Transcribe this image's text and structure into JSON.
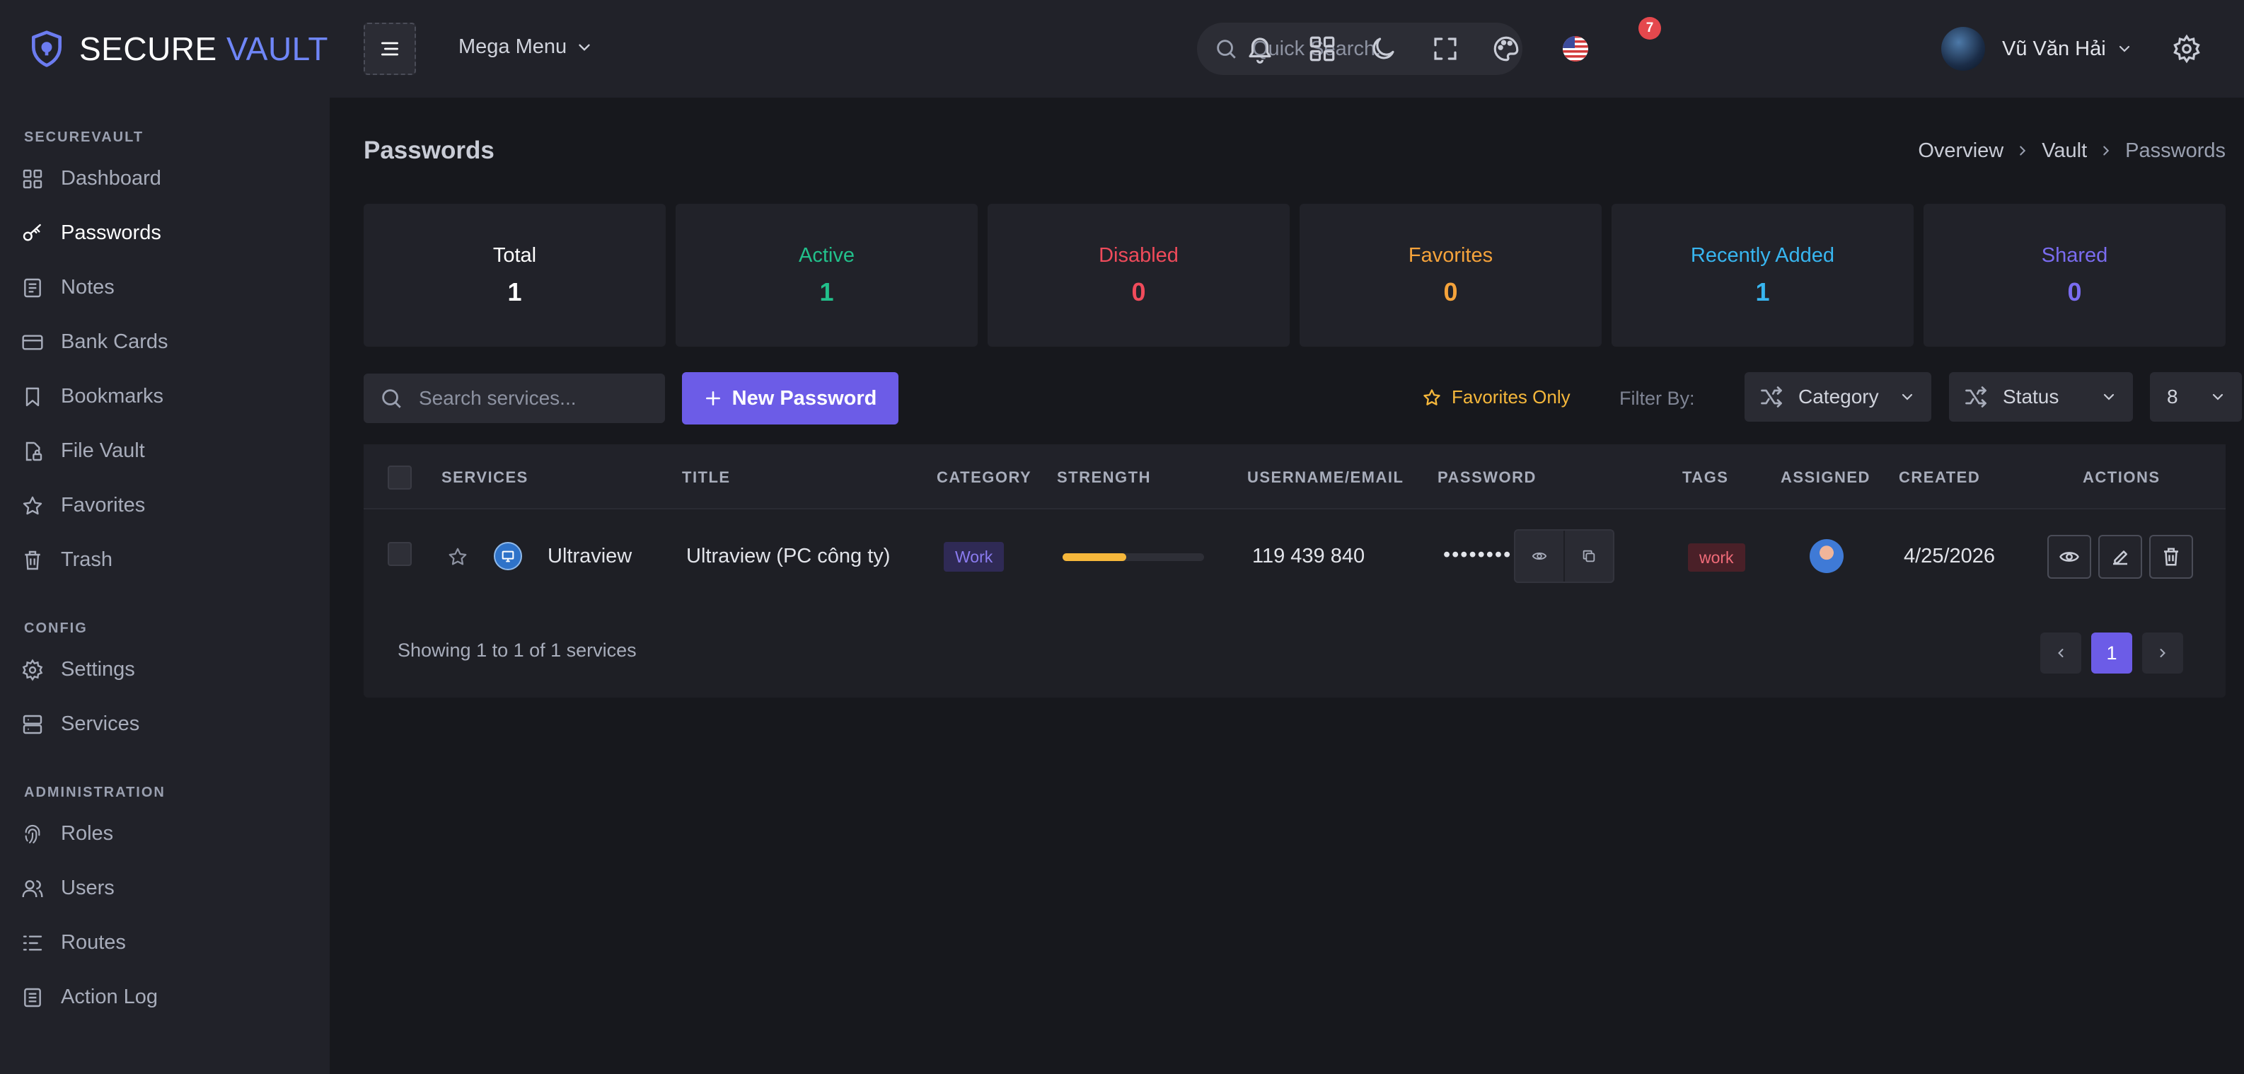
{
  "brand": {
    "name_main": "SECURE",
    "name_accent": "VAULT",
    "accent_color": "#6f86f7"
  },
  "sidebar": {
    "sections": [
      {
        "title": "SECUREVAULT",
        "items": [
          {
            "label": "Dashboard",
            "icon": "dashboard-icon"
          },
          {
            "label": "Passwords",
            "icon": "key-icon",
            "active": true
          },
          {
            "label": "Notes",
            "icon": "notes-icon"
          },
          {
            "label": "Bank Cards",
            "icon": "credit-card-icon"
          },
          {
            "label": "Bookmarks",
            "icon": "bookmark-icon"
          },
          {
            "label": "File Vault",
            "icon": "file-lock-icon"
          },
          {
            "label": "Favorites",
            "icon": "star-icon"
          },
          {
            "label": "Trash",
            "icon": "trash-icon"
          }
        ]
      },
      {
        "title": "CONFIG",
        "items": [
          {
            "label": "Settings",
            "icon": "gear-icon"
          },
          {
            "label": "Services",
            "icon": "server-icon"
          }
        ]
      },
      {
        "title": "ADMINISTRATION",
        "items": [
          {
            "label": "Roles",
            "icon": "fingerprint-icon"
          },
          {
            "label": "Users",
            "icon": "users-icon"
          },
          {
            "label": "Routes",
            "icon": "routes-icon"
          },
          {
            "label": "Action Log",
            "icon": "log-icon"
          }
        ]
      }
    ]
  },
  "topbar": {
    "mega_menu": "Mega Menu",
    "search_placeholder": "Quick Search...",
    "notification_count": "7",
    "user_name": "Vũ Văn Hải"
  },
  "page": {
    "title": "Passwords",
    "breadcrumb": [
      "Overview",
      "Vault",
      "Passwords"
    ]
  },
  "stats": [
    {
      "label": "Total",
      "value": "1",
      "color": "#ffffff"
    },
    {
      "label": "Active",
      "value": "1",
      "color": "#22c08b"
    },
    {
      "label": "Disabled",
      "value": "0",
      "color": "#f04b5b"
    },
    {
      "label": "Favorites",
      "value": "0",
      "color": "#f5a33b"
    },
    {
      "label": "Recently Added",
      "value": "1",
      "color": "#38b6f0"
    },
    {
      "label": "Shared",
      "value": "0",
      "color": "#7a6cf0"
    }
  ],
  "toolbar": {
    "search_placeholder": "Search services...",
    "new_button": "New Password",
    "favorites_only": "Favorites Only",
    "filter_by": "Filter By:",
    "category": "Category",
    "status": "Status",
    "page_size": "8"
  },
  "table": {
    "headers": [
      "SERVICES",
      "TITLE",
      "CATEGORY",
      "STRENGTH",
      "USERNAME/EMAIL",
      "PASSWORD",
      "TAGS",
      "ASSIGNED",
      "CREATED",
      "ACTIONS"
    ],
    "rows": [
      {
        "service": "Ultraview",
        "title": "Ultraview (PC công ty)",
        "category": "Work",
        "strength": 0.45,
        "username": "119 439 840",
        "password": "••••••••",
        "tag": "work",
        "created": "4/25/2026"
      }
    ],
    "footer": "Showing 1 to 1 of 1 services",
    "current_page": "1"
  }
}
